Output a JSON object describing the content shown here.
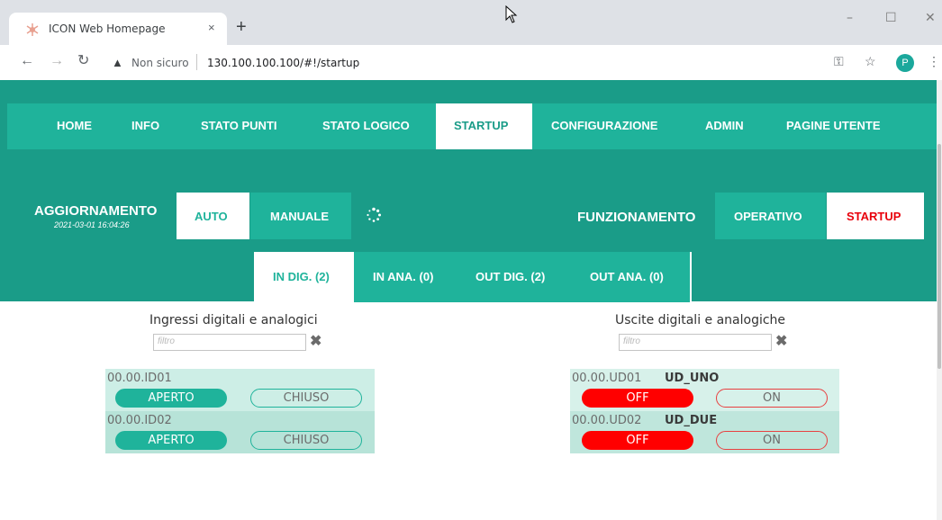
{
  "browser": {
    "tab_title": "ICON Web Homepage",
    "tab_close": "×",
    "new_tab": "+",
    "security_label": "Non sicuro",
    "url": "130.100.100.100/#!/startup",
    "profile_initial": "P",
    "window_controls": [
      "–",
      "☐",
      "✕"
    ]
  },
  "menu": {
    "items": [
      "HOME",
      "INFO",
      "STATO PUNTI",
      "STATO LOGICO",
      "STARTUP",
      "CONFIGURAZIONE",
      "ADMIN",
      "PAGINE UTENTE"
    ],
    "active": "STARTUP"
  },
  "update": {
    "title": "AGGIORNAMENTO",
    "timestamp": "2021-03-01 16:04:26",
    "auto_label": "AUTO",
    "manual_label": "MANUALE"
  },
  "mode": {
    "title": "FUNZIONAMENTO",
    "operativo_label": "OPERATIVO",
    "startup_label": "STARTUP"
  },
  "subtabs": {
    "items": [
      "IN DIG. (2)",
      "IN ANA. (0)",
      "OUT DIG. (2)",
      "OUT ANA. (0)"
    ],
    "active": "IN DIG. (2)"
  },
  "inputs": {
    "title": "Ingressi digitali e analogici",
    "filter_placeholder": "filtro",
    "rows": [
      {
        "id": "00.00.ID01",
        "left_label": "APERTO",
        "right_label": "CHIUSO"
      },
      {
        "id": "00.00.ID02",
        "left_label": "APERTO",
        "right_label": "CHIUSO"
      }
    ]
  },
  "outputs": {
    "title": "Uscite digitali e analogiche",
    "filter_placeholder": "filtro",
    "rows": [
      {
        "id": "00.00.UD01",
        "name": "UD_UNO",
        "left_label": "OFF",
        "right_label": "ON"
      },
      {
        "id": "00.00.UD02",
        "name": "UD_DUE",
        "left_label": "OFF",
        "right_label": "ON"
      }
    ]
  },
  "icons": {
    "clear": "✖",
    "back": "←",
    "forward": "→",
    "reload": "↻",
    "warning": "▲",
    "key": "⚿",
    "star": "☆",
    "more": "⋮"
  },
  "colors": {
    "header": "#1a9c88",
    "accent": "#1fb39b",
    "alert_red": "#ff0000"
  }
}
